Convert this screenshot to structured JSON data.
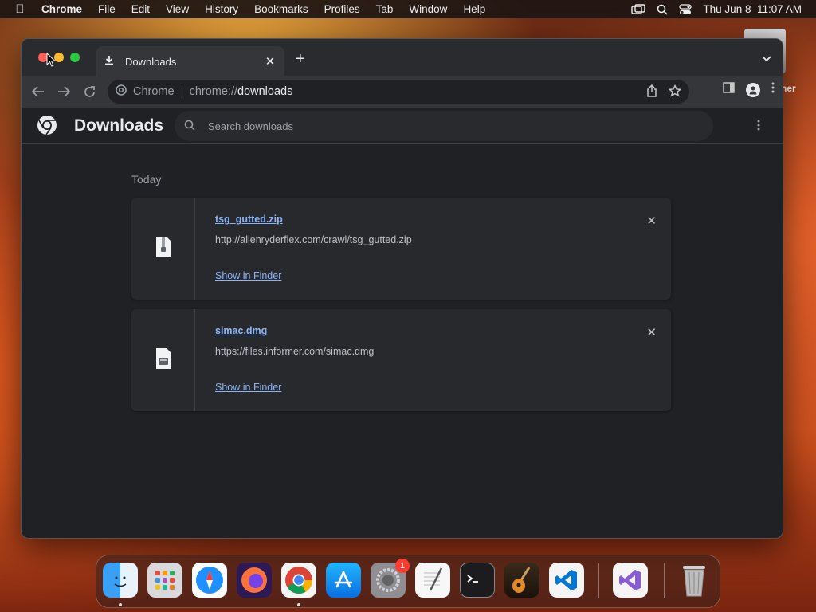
{
  "menubar": {
    "apple_icon": "apple-logo-icon",
    "app_name": "Chrome",
    "items": [
      "File",
      "Edit",
      "View",
      "History",
      "Bookmarks",
      "Profiles",
      "Tab",
      "Window",
      "Help"
    ],
    "clock": "Thu Jun 8  11:07 AM",
    "status_icons": [
      "screen-mirroring-icon",
      "spotlight-search-icon",
      "control-center-icon"
    ]
  },
  "desktop": {
    "label": "ner"
  },
  "browser": {
    "tab": {
      "title": "Downloads",
      "icon": "download-icon"
    },
    "omnibox": {
      "chip_label": "Chrome",
      "scheme": "chrome://",
      "host": "downloads"
    }
  },
  "downloads_page": {
    "title": "Downloads",
    "search_placeholder": "Search downloads",
    "section_label": "Today",
    "items": [
      {
        "file_name": "tsg_gutted.zip",
        "url": "http://alienryderflex.com/crawl/tsg_gutted.zip",
        "action_label": "Show in Finder",
        "file_icon": "zip-file-icon"
      },
      {
        "file_name": "simac.dmg",
        "url": "https://files.informer.com/simac.dmg",
        "action_label": "Show in Finder",
        "file_icon": "disk-image-file-icon"
      }
    ]
  },
  "dock": {
    "apps": [
      "Finder",
      "Launchpad",
      "Safari",
      "Firefox",
      "Google Chrome",
      "App Store",
      "System Settings",
      "TextEdit",
      "Terminal",
      "GarageBand",
      "Visual Studio Code",
      "Visual Studio",
      "Trash"
    ],
    "settings_badge": "1"
  },
  "colors": {
    "window_bg": "#202124",
    "toolbar_bg": "#35363a",
    "link": "#8ab4f8",
    "text_primary": "#e8eaed",
    "text_secondary": "#9aa0a6"
  }
}
